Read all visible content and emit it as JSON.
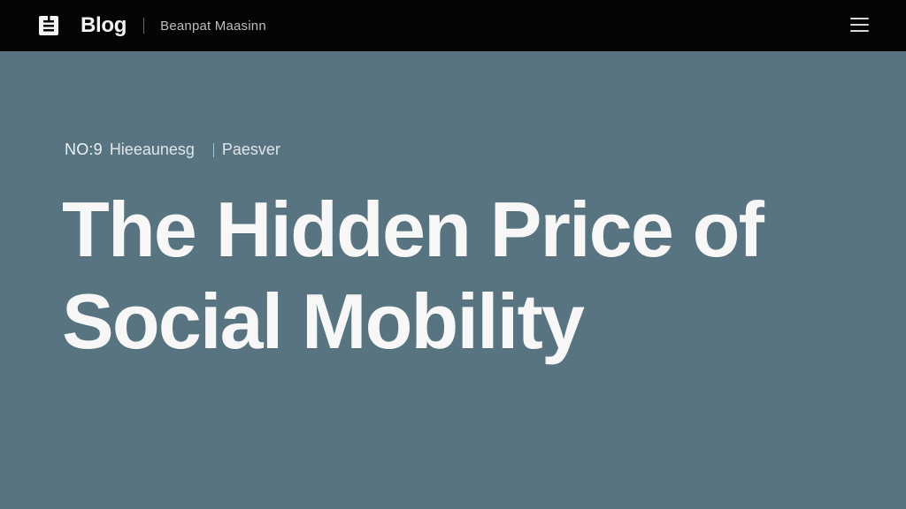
{
  "header": {
    "brand_label": "Blog",
    "publication_name": "Beanpat Maasinn",
    "menu_icon": "hamburger-menu-icon",
    "logo_icon": "document-icon"
  },
  "article": {
    "issue": "NO:9",
    "section": "Hieeaunesg",
    "category": "Paesver",
    "title_line_1": "The Hidden Price of",
    "title_line_2": "Social Mobility"
  },
  "colors": {
    "header_bg": "#050505",
    "hero_bg": "#587480",
    "title_text": "#f7f7f7"
  }
}
